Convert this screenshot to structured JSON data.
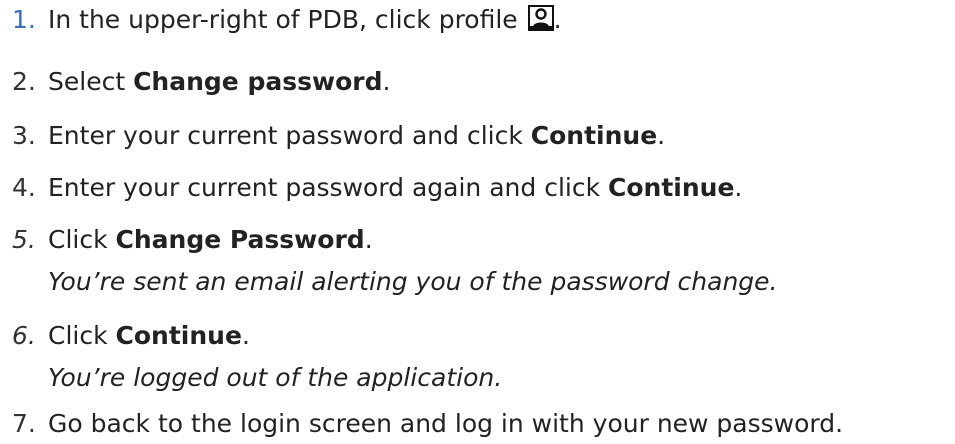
{
  "steps": [
    {
      "num": "1.",
      "parts": {
        "a": "In the upper-right of PDB, click profile",
        "end": "."
      },
      "icon": "profile-icon"
    },
    {
      "num": "2.",
      "parts": {
        "a": "Select ",
        "bold": "Change password",
        "end": "."
      }
    },
    {
      "num": "3.",
      "parts": {
        "a": "Enter your current password and click ",
        "bold": "Continue",
        "end": "."
      }
    },
    {
      "num": "4.",
      "parts": {
        "a": "Enter your current password again and click ",
        "bold": "Continue",
        "end": "."
      }
    },
    {
      "num": "5.",
      "parts": {
        "a": "Click ",
        "bold": "Change Password",
        "end": "."
      },
      "note": "You’re sent an email alerting you of the password change."
    },
    {
      "num": "6.",
      "parts": {
        "a": "Click ",
        "bold": "Continue",
        "end": "."
      },
      "note": "You’re logged out of the application."
    },
    {
      "num": "7.",
      "parts": {
        "a": "Go back to the login screen and log in with your new password."
      }
    }
  ],
  "colors": {
    "step1_number": "#3b6fb6",
    "text": "#222222"
  }
}
